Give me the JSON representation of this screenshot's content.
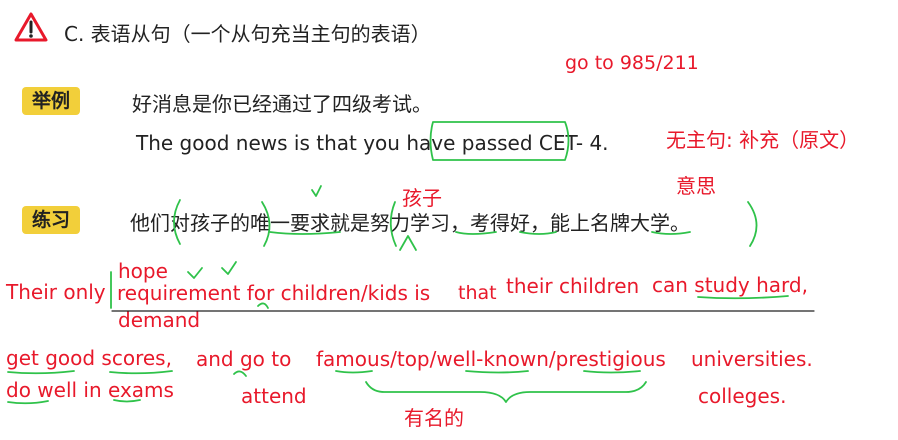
{
  "header": {
    "section_title": "C. 表语从句（一个从句充当主句的表语）",
    "note_goal": "go to 985/211"
  },
  "example": {
    "tag": "举例",
    "chinese": "好消息是你已经通过了四级考试。",
    "english_prefix": "The good news is that you ",
    "english_highlight": "have passed",
    "english_suffix": " CET- 4.",
    "note_no_subject": "无主句: 补充（原文）",
    "note_meaning": "意思"
  },
  "practice": {
    "tag": "练习",
    "chinese": "他们对孩子的唯一要求就是努力学习，考得好，能上名牌大学。",
    "note_children": "孩子"
  },
  "answer": {
    "line1_part1": "Their only ",
    "line1_part2": "requirement for children/kids is",
    "line1_that": "that",
    "line1_part3": "their children",
    "line1_part4": "can study hard,",
    "alt_hope": "hope",
    "alt_demand": "demand",
    "line2_part1": "get good scores,",
    "line2_part2": "and go to",
    "line2_part3": "famous/top/well-known/prestigious",
    "line2_part4": "universities.",
    "line3_part1": "do well in exams",
    "line3_attend": "attend",
    "line3_famous_cn": "有名的",
    "line3_colleges": "colleges."
  }
}
